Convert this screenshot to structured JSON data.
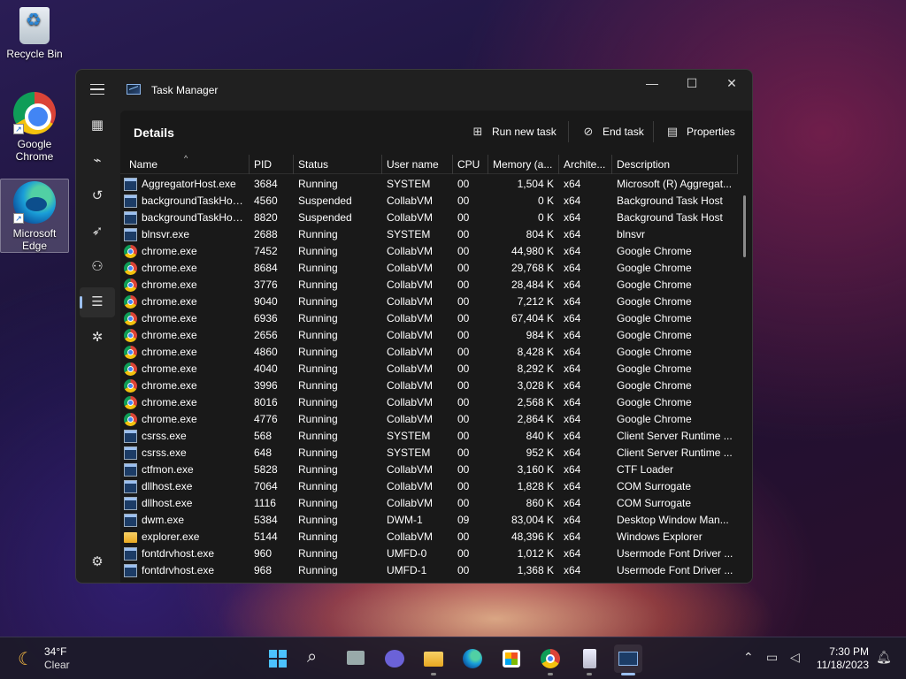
{
  "desktop": {
    "icons": [
      {
        "label": "Recycle Bin"
      },
      {
        "label": "Google Chrome"
      },
      {
        "label": "Microsoft Edge"
      }
    ]
  },
  "window": {
    "title": "Task Manager",
    "page_title": "Details",
    "commands": {
      "run_new_task": "Run new task",
      "end_task": "End task",
      "properties": "Properties"
    },
    "columns": [
      "Name",
      "PID",
      "Status",
      "User name",
      "CPU",
      "Memory (a...",
      "Archite...",
      "Description"
    ],
    "rows": [
      {
        "icon": "exe",
        "name": "AggregatorHost.exe",
        "pid": "3684",
        "status": "Running",
        "user": "SYSTEM",
        "cpu": "00",
        "mem": "1,504 K",
        "arch": "x64",
        "desc": "Microsoft (R) Aggregat..."
      },
      {
        "icon": "exe",
        "name": "backgroundTaskHost...",
        "pid": "4560",
        "status": "Suspended",
        "user": "CollabVM",
        "cpu": "00",
        "mem": "0 K",
        "arch": "x64",
        "desc": "Background Task Host"
      },
      {
        "icon": "exe",
        "name": "backgroundTaskHost...",
        "pid": "8820",
        "status": "Suspended",
        "user": "CollabVM",
        "cpu": "00",
        "mem": "0 K",
        "arch": "x64",
        "desc": "Background Task Host"
      },
      {
        "icon": "exe",
        "name": "blnsvr.exe",
        "pid": "2688",
        "status": "Running",
        "user": "SYSTEM",
        "cpu": "00",
        "mem": "804 K",
        "arch": "x64",
        "desc": "blnsvr"
      },
      {
        "icon": "chrome",
        "name": "chrome.exe",
        "pid": "7452",
        "status": "Running",
        "user": "CollabVM",
        "cpu": "00",
        "mem": "44,980 K",
        "arch": "x64",
        "desc": "Google Chrome"
      },
      {
        "icon": "chrome",
        "name": "chrome.exe",
        "pid": "8684",
        "status": "Running",
        "user": "CollabVM",
        "cpu": "00",
        "mem": "29,768 K",
        "arch": "x64",
        "desc": "Google Chrome"
      },
      {
        "icon": "chrome",
        "name": "chrome.exe",
        "pid": "3776",
        "status": "Running",
        "user": "CollabVM",
        "cpu": "00",
        "mem": "28,484 K",
        "arch": "x64",
        "desc": "Google Chrome"
      },
      {
        "icon": "chrome",
        "name": "chrome.exe",
        "pid": "9040",
        "status": "Running",
        "user": "CollabVM",
        "cpu": "00",
        "mem": "7,212 K",
        "arch": "x64",
        "desc": "Google Chrome"
      },
      {
        "icon": "chrome",
        "name": "chrome.exe",
        "pid": "6936",
        "status": "Running",
        "user": "CollabVM",
        "cpu": "00",
        "mem": "67,404 K",
        "arch": "x64",
        "desc": "Google Chrome"
      },
      {
        "icon": "chrome",
        "name": "chrome.exe",
        "pid": "2656",
        "status": "Running",
        "user": "CollabVM",
        "cpu": "00",
        "mem": "984 K",
        "arch": "x64",
        "desc": "Google Chrome"
      },
      {
        "icon": "chrome",
        "name": "chrome.exe",
        "pid": "4860",
        "status": "Running",
        "user": "CollabVM",
        "cpu": "00",
        "mem": "8,428 K",
        "arch": "x64",
        "desc": "Google Chrome"
      },
      {
        "icon": "chrome",
        "name": "chrome.exe",
        "pid": "4040",
        "status": "Running",
        "user": "CollabVM",
        "cpu": "00",
        "mem": "8,292 K",
        "arch": "x64",
        "desc": "Google Chrome"
      },
      {
        "icon": "chrome",
        "name": "chrome.exe",
        "pid": "3996",
        "status": "Running",
        "user": "CollabVM",
        "cpu": "00",
        "mem": "3,028 K",
        "arch": "x64",
        "desc": "Google Chrome"
      },
      {
        "icon": "chrome",
        "name": "chrome.exe",
        "pid": "8016",
        "status": "Running",
        "user": "CollabVM",
        "cpu": "00",
        "mem": "2,568 K",
        "arch": "x64",
        "desc": "Google Chrome"
      },
      {
        "icon": "chrome",
        "name": "chrome.exe",
        "pid": "4776",
        "status": "Running",
        "user": "CollabVM",
        "cpu": "00",
        "mem": "2,864 K",
        "arch": "x64",
        "desc": "Google Chrome"
      },
      {
        "icon": "exe",
        "name": "csrss.exe",
        "pid": "568",
        "status": "Running",
        "user": "SYSTEM",
        "cpu": "00",
        "mem": "840 K",
        "arch": "x64",
        "desc": "Client Server Runtime ..."
      },
      {
        "icon": "exe",
        "name": "csrss.exe",
        "pid": "648",
        "status": "Running",
        "user": "SYSTEM",
        "cpu": "00",
        "mem": "952 K",
        "arch": "x64",
        "desc": "Client Server Runtime ..."
      },
      {
        "icon": "exe",
        "name": "ctfmon.exe",
        "pid": "5828",
        "status": "Running",
        "user": "CollabVM",
        "cpu": "00",
        "mem": "3,160 K",
        "arch": "x64",
        "desc": "CTF Loader"
      },
      {
        "icon": "exe",
        "name": "dllhost.exe",
        "pid": "7064",
        "status": "Running",
        "user": "CollabVM",
        "cpu": "00",
        "mem": "1,828 K",
        "arch": "x64",
        "desc": "COM Surrogate"
      },
      {
        "icon": "exe",
        "name": "dllhost.exe",
        "pid": "1116",
        "status": "Running",
        "user": "CollabVM",
        "cpu": "00",
        "mem": "860 K",
        "arch": "x64",
        "desc": "COM Surrogate"
      },
      {
        "icon": "exe",
        "name": "dwm.exe",
        "pid": "5384",
        "status": "Running",
        "user": "DWM-1",
        "cpu": "09",
        "mem": "83,004 K",
        "arch": "x64",
        "desc": "Desktop Window Man..."
      },
      {
        "icon": "folder",
        "name": "explorer.exe",
        "pid": "5144",
        "status": "Running",
        "user": "CollabVM",
        "cpu": "00",
        "mem": "48,396 K",
        "arch": "x64",
        "desc": "Windows Explorer"
      },
      {
        "icon": "exe",
        "name": "fontdrvhost.exe",
        "pid": "960",
        "status": "Running",
        "user": "UMFD-0",
        "cpu": "00",
        "mem": "1,012 K",
        "arch": "x64",
        "desc": "Usermode Font Driver ..."
      },
      {
        "icon": "exe",
        "name": "fontdrvhost.exe",
        "pid": "968",
        "status": "Running",
        "user": "UMFD-1",
        "cpu": "00",
        "mem": "1,368 K",
        "arch": "x64",
        "desc": "Usermode Font Driver ..."
      }
    ]
  },
  "taskbar": {
    "weather_temp": "34°F",
    "weather_desc": "Clear",
    "time": "7:30 PM",
    "date": "11/18/2023"
  },
  "icons": {
    "menu": "hamburger-icon",
    "processes": "processes-icon",
    "performance": "performance-icon",
    "app_history": "history-icon",
    "startup": "startup-icon",
    "users": "users-icon",
    "details": "details-icon",
    "services": "services-icon",
    "settings": "gear-icon"
  }
}
